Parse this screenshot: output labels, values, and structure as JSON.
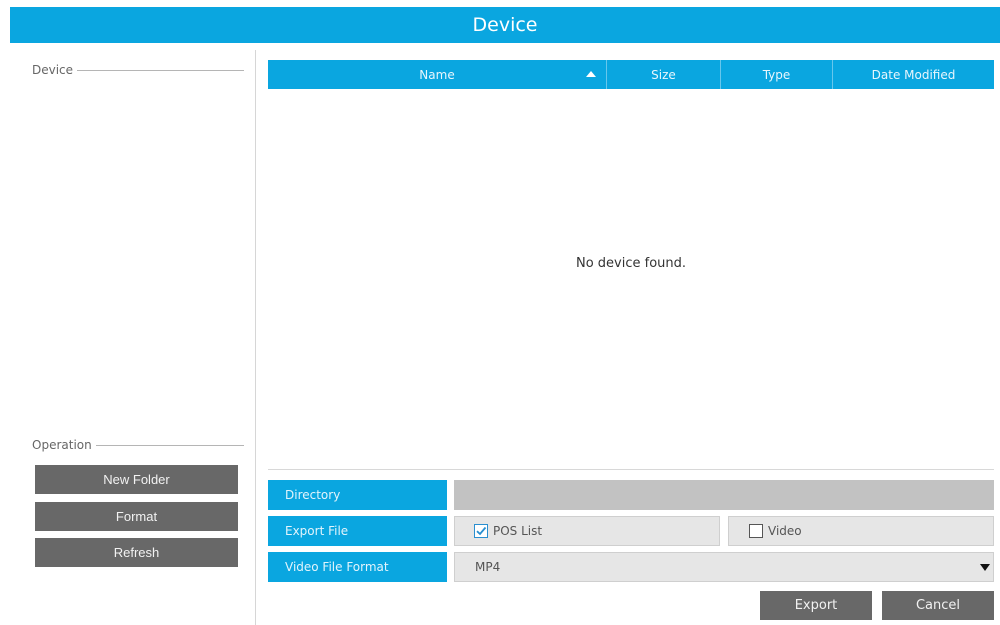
{
  "window": {
    "title": "Device"
  },
  "left": {
    "device_legend": "Device",
    "operation_legend": "Operation",
    "buttons": [
      {
        "label": "New Folder"
      },
      {
        "label": "Format"
      },
      {
        "label": "Refresh"
      }
    ]
  },
  "table": {
    "columns": [
      "Name",
      "Size",
      "Type",
      "Date Modified"
    ],
    "sort_column": "Name",
    "sort_direction": "ascending",
    "rows": [],
    "empty_message": "No device found."
  },
  "form": {
    "directory": {
      "label": "Directory",
      "value": ""
    },
    "export_file": {
      "label": "Export File",
      "options": [
        {
          "label": "POS List",
          "checked": true
        },
        {
          "label": "Video",
          "checked": false
        }
      ]
    },
    "video_file_format": {
      "label": "Video File Format",
      "value": "MP4"
    }
  },
  "actions": {
    "export": "Export",
    "cancel": "Cancel"
  },
  "colors": {
    "accent": "#0aa6e0",
    "button": "#686868",
    "field": "#e6e6e6",
    "directory_field": "#c2c2c2"
  }
}
